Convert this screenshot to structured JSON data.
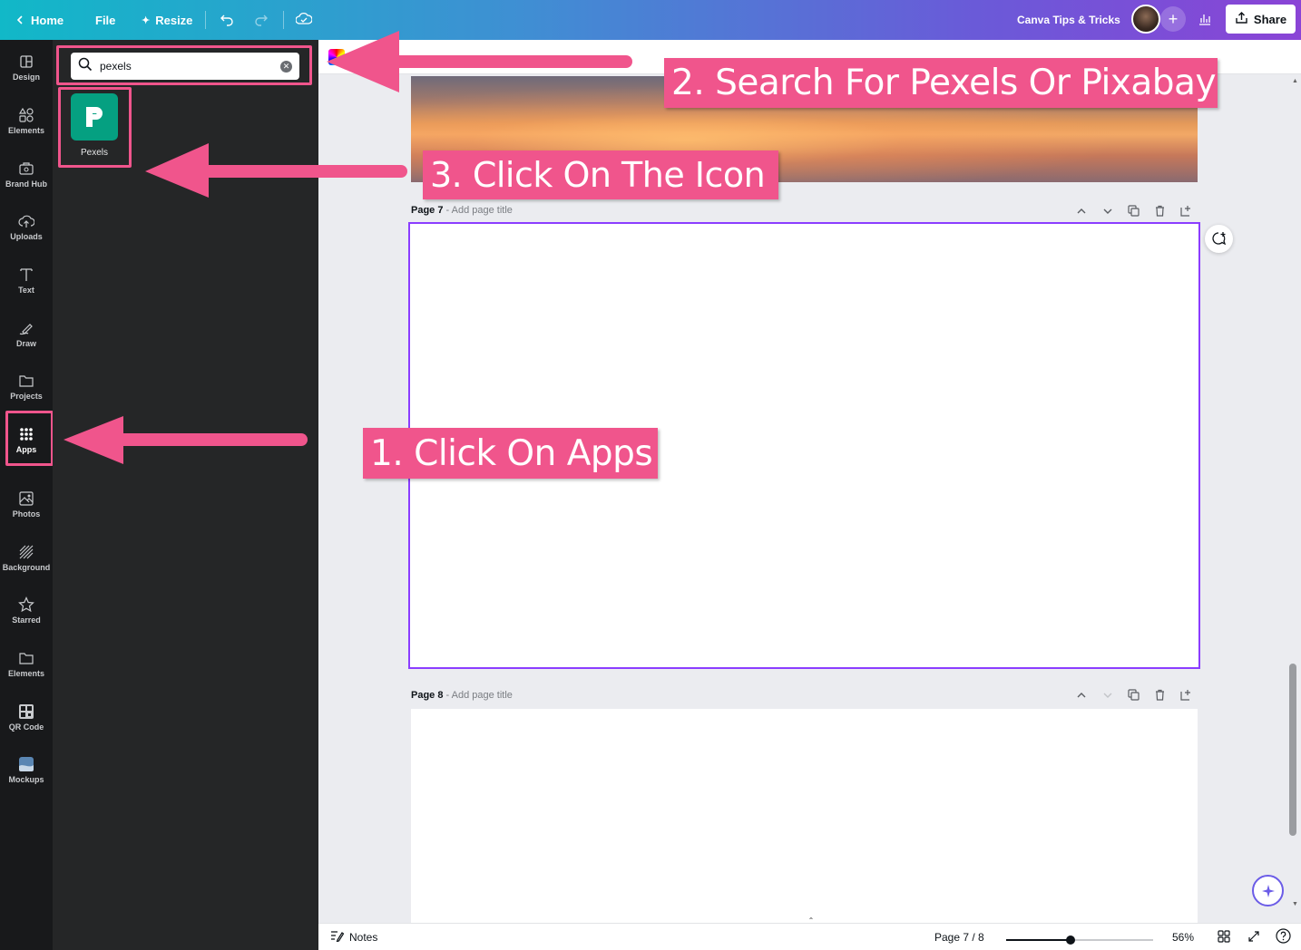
{
  "topbar": {
    "home_label": "Home",
    "file_label": "File",
    "resize_label": "Resize",
    "team_name": "Canva Tips & Tricks",
    "share_label": "Share"
  },
  "rail": {
    "items": [
      {
        "label": "Design",
        "icon": "layout-icon"
      },
      {
        "label": "Elements",
        "icon": "shapes-icon"
      },
      {
        "label": "Brand Hub",
        "icon": "briefcase-icon"
      },
      {
        "label": "Uploads",
        "icon": "cloud-upload-icon"
      },
      {
        "label": "Text",
        "icon": "text-icon"
      },
      {
        "label": "Draw",
        "icon": "pen-icon"
      },
      {
        "label": "Projects",
        "icon": "folder-icon"
      },
      {
        "label": "Apps",
        "icon": "grid-icon"
      },
      {
        "label": "Photos",
        "icon": "image-icon"
      },
      {
        "label": "Background",
        "icon": "hatch-icon"
      },
      {
        "label": "Starred",
        "icon": "star-icon"
      },
      {
        "label": "Elements",
        "icon": "folder-icon"
      },
      {
        "label": "QR Code",
        "icon": "qr-icon"
      },
      {
        "label": "Mockups",
        "icon": "mockup-icon"
      }
    ],
    "active": "Apps"
  },
  "panel": {
    "search_value": "pexels",
    "results": [
      {
        "label": "Pexels",
        "color": "#05a081"
      }
    ]
  },
  "canvas": {
    "page7": {
      "label": "Page 7",
      "title_placeholder": "- Add page title"
    },
    "page8": {
      "label": "Page 8",
      "title_placeholder": "- Add page title"
    }
  },
  "bottombar": {
    "notes_label": "Notes",
    "page_indicator": "Page 7 / 8",
    "zoom_label": "56%",
    "zoom_fraction": 0.44
  },
  "annotations": {
    "step1": "1. Click On Apps",
    "step2": "2. Search For Pexels Or Pixabay",
    "step3": "3. Click On The Icon",
    "color": "#f0558c"
  }
}
